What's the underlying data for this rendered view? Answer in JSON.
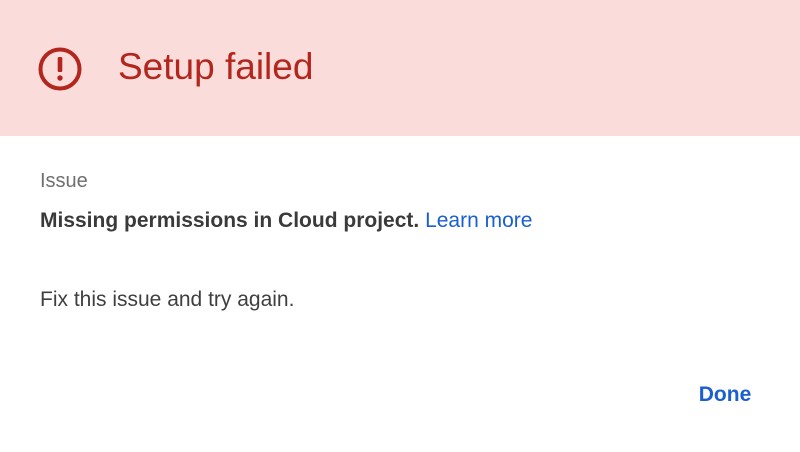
{
  "header": {
    "title": "Setup failed",
    "icon": "error-icon",
    "background_color": "#fadcdb",
    "accent_color": "#b3261e"
  },
  "body": {
    "section_label": "Issue",
    "issue_text": "Missing permissions in Cloud project.",
    "learn_more_label": "Learn more",
    "instruction": "Fix this issue and try again."
  },
  "actions": {
    "done_label": "Done",
    "link_color": "#1a5fd0"
  }
}
